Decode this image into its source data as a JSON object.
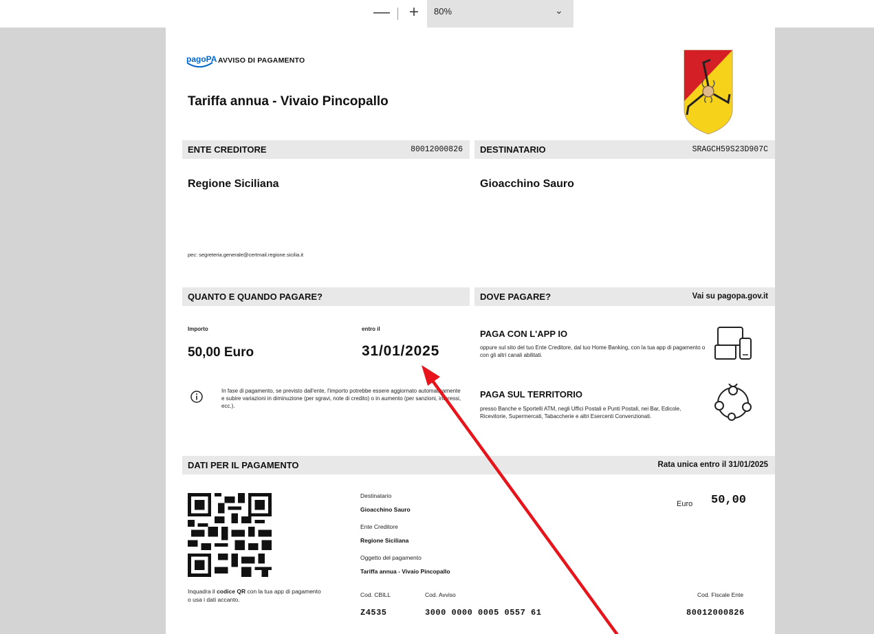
{
  "toolbar": {
    "zoom_out_symbol": "—",
    "zoom_in_symbol": "+",
    "zoom_level": "80%",
    "chevron": "⌄"
  },
  "header": {
    "logo_text": "pagoPA",
    "brand_label": "AVVISO DI PAGAMENTO",
    "title": "Tariffa annua - Vivaio Pincopallo"
  },
  "ente": {
    "header": "ENTE CREDITORE",
    "code": "80012000826",
    "name": "Regione Siciliana",
    "pec": "pec: segreteria.generale@certmail.regione.sicilia.it"
  },
  "destinatario": {
    "header": "DESTINATARIO",
    "code": "SRAGCH59S23D907C",
    "name": "Gioacchino Sauro"
  },
  "quanto": {
    "header": "QUANTO E QUANDO PAGARE?",
    "importo_label": "Importo",
    "importo_value": "50,00 Euro",
    "entro_label": "entro il",
    "entro_value": "31/01/2025",
    "info_text": "In fase di pagamento, se previsto dall'ente, l'importo potrebbe essere aggiornato automaticamente e subire variazioni in diminuzione (per sgravi, note di credito) o in aumento (per sanzioni, interessi, ecc.)."
  },
  "dove": {
    "header": "DOVE PAGARE?",
    "link_prefix": "Vai su ",
    "link_text": "pagopa.gov.it",
    "app_title": "PAGA CON L'APP IO",
    "app_text": "oppure sul sito del tuo Ente Creditore, dal tuo Home Banking, con la tua app di pagamento o con gli altri canali abilitati.",
    "territorio_title": "PAGA SUL TERRITORIO",
    "territorio_text": "presso Banche e Sportelli ATM, negli Uffici Postali e Punti Postali, nei Bar, Edicole, Ricevitorie, Supermercati, Tabaccherie e altri Esercenti Convenzionati."
  },
  "dati": {
    "header": "DATI PER IL PAGAMENTO",
    "rata": "Rata unica entro il 31/01/2025",
    "qr_caption_pre": "Inquadra il ",
    "qr_caption_bold": "codice QR",
    "qr_caption_post": " con la tua app di pagamento o usa i dati accanto.",
    "destinatario_label": "Destinatario",
    "destinatario_value": "Gioacchino Sauro",
    "ente_label": "Ente Creditore",
    "ente_value": "Regione Siciliana",
    "oggetto_label": "Oggetto del pagamento",
    "oggetto_value": "Tariffa annua - Vivaio Pincopallo",
    "euro_label": "Euro",
    "euro_value": "50,00",
    "cbill_label": "Cod. CBILL",
    "cbill_value": "Z4535",
    "avviso_label": "Cod. Avviso",
    "avviso_value": "3000 0000 0005 0557 61",
    "fiscale_label": "Cod. Fiscale Ente",
    "fiscale_value": "80012000826"
  },
  "colors": {
    "page": "#ffffff",
    "background": "#d4d4d4",
    "header_bar": "#e8e8e8",
    "pagopa_blue": "#0066cc",
    "annotation_arrow": "#e8141b",
    "crest_red": "#d51f26",
    "crest_yellow": "#f7d21a"
  },
  "icons": [
    "zoom-out-icon",
    "zoom-in-icon",
    "chevron-down-icon",
    "info-icon",
    "devices-icon",
    "location-network-icon",
    "qr-code",
    "coat-of-arms-sicily",
    "annotation-arrow"
  ]
}
